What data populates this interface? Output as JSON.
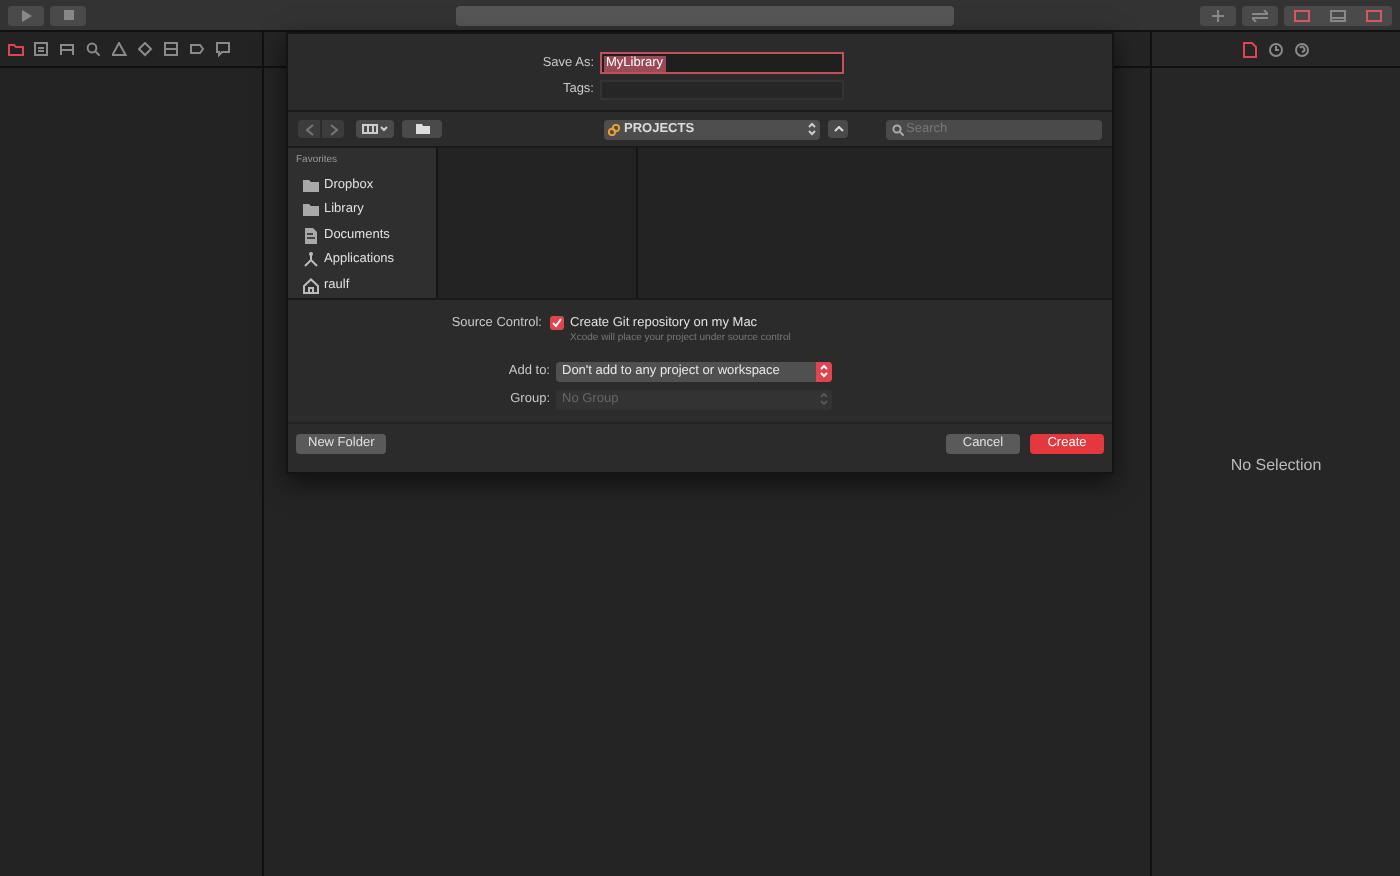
{
  "toolbar": {
    "panel_toggles": [
      {
        "selected": true
      },
      {
        "selected": false
      },
      {
        "selected": true
      }
    ]
  },
  "navigator_tabs": [
    {
      "selected": true
    },
    {
      "selected": false
    },
    {
      "selected": false
    },
    {
      "selected": false
    },
    {
      "selected": false
    },
    {
      "selected": false
    },
    {
      "selected": false
    },
    {
      "selected": false
    },
    {
      "selected": false
    }
  ],
  "dialog": {
    "save_as": {
      "label": "Save As:",
      "value": "MyLibrary"
    },
    "tags": {
      "label": "Tags:"
    },
    "location": "PROJECTS",
    "search": {
      "placeholder": "Search"
    },
    "sidebar": {
      "heading": "Favorites",
      "items": [
        {
          "label": "Dropbox",
          "kind": "folder"
        },
        {
          "label": "Library",
          "kind": "folder"
        },
        {
          "label": "Documents",
          "kind": "document"
        },
        {
          "label": "Applications",
          "kind": "apps"
        },
        {
          "label": "raulf",
          "kind": "home"
        }
      ]
    },
    "source_control": {
      "label": "Source Control:",
      "checked": true,
      "option": "Create Git repository on my Mac",
      "note": "Xcode will place your project under source control"
    },
    "add_to": {
      "label": "Add to:",
      "value": "Don't add to any project or workspace",
      "disabled": false
    },
    "group": {
      "label": "Group:",
      "value": "No Group",
      "disabled": true
    },
    "buttons": [
      {
        "label": "New Folder",
        "kind": "secondary"
      },
      {
        "label": "Cancel",
        "kind": "secondary"
      },
      {
        "label": "Create",
        "kind": "default"
      }
    ]
  },
  "inspector": {
    "tabs": [
      {
        "selected": true
      },
      {
        "selected": false
      },
      {
        "selected": false
      }
    ],
    "empty_text": "No Selection"
  }
}
